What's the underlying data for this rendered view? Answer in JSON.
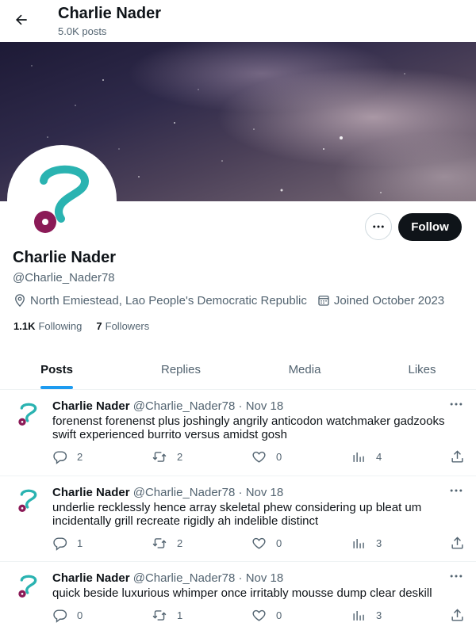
{
  "header": {
    "back_icon": "arrow-left-icon",
    "title": "Charlie Nader",
    "posts_count": "5.0K posts"
  },
  "profile": {
    "name": "Charlie Nader",
    "handle": "@Charlie_Nader78",
    "location": "North Emiestead, Lao People's Democratic Republic",
    "joined": "Joined October 2023",
    "following_count": "1.1K",
    "following_label": "Following",
    "followers_count": "7",
    "followers_label": "Followers",
    "follow_button": "Follow",
    "avatar_colors": {
      "hook": "#2ab3b1",
      "dot": "#8b1a57"
    }
  },
  "tabs": [
    "Posts",
    "Replies",
    "Media",
    "Likes"
  ],
  "active_tab": "Posts",
  "posts": [
    {
      "name": "Charlie Nader",
      "handle": "@Charlie_Nader78",
      "date": "Nov 18",
      "sep": "·",
      "text": "forenenst forenenst plus joshingly angrily anticodon watchmaker gadzooks swift experienced burrito versus amidst gosh",
      "replies": "2",
      "reposts": "2",
      "likes": "0",
      "views": "4"
    },
    {
      "name": "Charlie Nader",
      "handle": "@Charlie_Nader78",
      "date": "Nov 18",
      "sep": "·",
      "text": "underlie recklessly hence array skeletal phew considering up bleat um incidentally grill recreate rigidly ah indelible distinct",
      "replies": "1",
      "reposts": "2",
      "likes": "0",
      "views": "3"
    },
    {
      "name": "Charlie Nader",
      "handle": "@Charlie_Nader78",
      "date": "Nov 18",
      "sep": "·",
      "text": "quick beside luxurious whimper once irritably mousse dump clear deskill",
      "replies": "0",
      "reposts": "1",
      "likes": "0",
      "views": "3"
    }
  ],
  "colors": {
    "accent": "#1d9bf0",
    "text": "#0f1419",
    "secondary": "#536471"
  }
}
